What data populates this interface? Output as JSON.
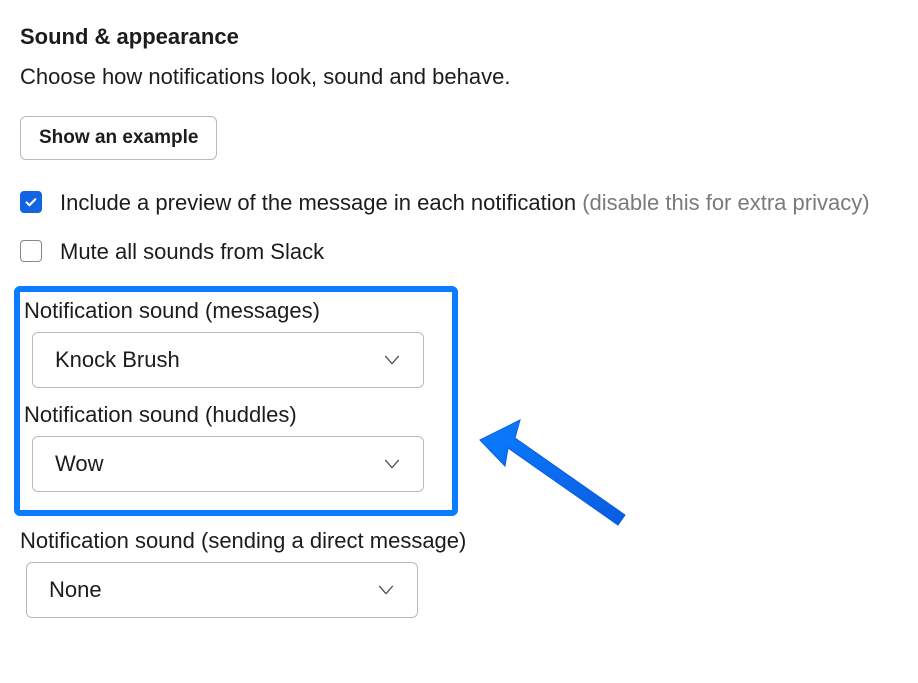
{
  "section": {
    "title": "Sound & appearance",
    "description": "Choose how notifications look, sound and behave.",
    "exampleButton": "Show an example"
  },
  "checkboxes": {
    "preview": {
      "label": "Include a preview of the message in each notification ",
      "hint": "(disable this for extra privacy)",
      "checked": true
    },
    "mute": {
      "label": "Mute all sounds from Slack",
      "checked": false
    }
  },
  "sounds": {
    "messages": {
      "label": "Notification sound (messages)",
      "value": "Knock Brush"
    },
    "huddles": {
      "label": "Notification sound (huddles)",
      "value": "Wow"
    },
    "dm": {
      "label": "Notification sound (sending a direct message)",
      "value": "None"
    }
  },
  "colors": {
    "highlight": "#0a7cff",
    "checkboxChecked": "#1264e3"
  }
}
